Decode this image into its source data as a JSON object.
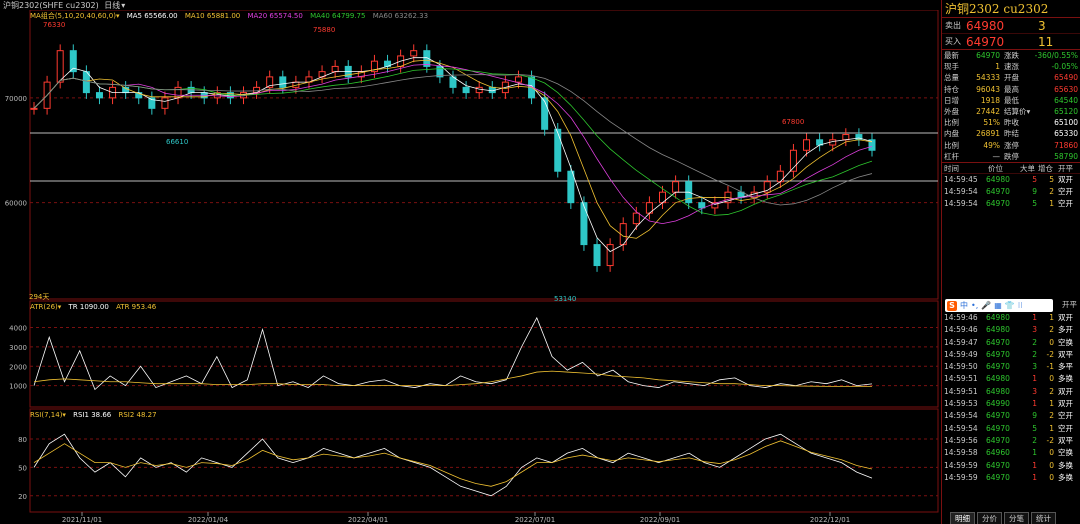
{
  "topbar": {
    "symbol": "沪铜2302(SHFE cu2302)",
    "period": "日线",
    "arrow": "▾"
  },
  "ma": {
    "title": "MA组合(5,10,20,40,60,0)",
    "arrow": "▾",
    "ma5": "MA5 65566.00",
    "ma10": "MA10 65881.00",
    "ma20": "MA20 65574.50",
    "ma40": "MA40 64799.75",
    "ma60": "MA60 63262.33",
    "colors": {
      "ma5": "#ffffff",
      "ma10": "#f1c232",
      "ma20": "#e040e0",
      "ma40": "#2ec72e",
      "ma60": "#888888"
    }
  },
  "price_labels": {
    "high1": "76330",
    "high2": "75880",
    "low1": "66610",
    "high3": "67800",
    "low2": "53140",
    "bars": "294天"
  },
  "atr": {
    "title": "ATR(26)",
    "arrow": "▾",
    "tr": "TR 1090.00",
    "atr": "ATR 953.46"
  },
  "rsi": {
    "title": "RSI(7,14)",
    "arrow": "▾",
    "rsi1": "RSI1 38.66",
    "rsi2": "RSI2 48.27"
  },
  "chart_data": [
    {
      "type": "candlestick",
      "title": "沪铜2302 cu2302 日线",
      "y_ticks": [
        70000,
        60000
      ],
      "x_ticks": [
        "2021/11/01",
        "2022/01/04",
        "2022/04/01",
        "2022/07/01",
        "2022/09/01",
        "2022/12/01"
      ],
      "annotations": {
        "high": 76330,
        "high2": 75880,
        "low": 66610,
        "high3": 67800,
        "low2": 53140
      },
      "close": [
        69000,
        71500,
        74500,
        72500,
        70500,
        70000,
        71000,
        70500,
        70000,
        69000,
        70000,
        71000,
        70500,
        70000,
        70500,
        70000,
        70500,
        71000,
        72000,
        71000,
        71500,
        72000,
        72500,
        73000,
        72000,
        72500,
        73500,
        73000,
        74000,
        74500,
        73000,
        72000,
        71000,
        70500,
        71000,
        70500,
        71500,
        72000,
        70000,
        67000,
        63000,
        60000,
        56000,
        54000,
        56000,
        58000,
        59000,
        60000,
        61000,
        62000,
        60000,
        59500,
        60000,
        61000,
        60500,
        61000,
        62000,
        63000,
        65000,
        66000,
        65500,
        66000,
        66500,
        66000,
        65000
      ]
    },
    {
      "type": "line",
      "title": "ATR(26)",
      "y_ticks": [
        4000,
        3000,
        2000,
        1000
      ],
      "series": [
        {
          "name": "TR",
          "values": [
            1000,
            3500,
            1200,
            2800,
            800,
            1500,
            1000,
            2000,
            900,
            1200,
            1500,
            1100,
            2500,
            900,
            1300,
            3900,
            1000,
            1200,
            900,
            1500,
            1100,
            1000,
            1200,
            1300,
            1000,
            900,
            1100,
            1000,
            1500,
            1200,
            1100,
            1300,
            3000,
            4500,
            2500,
            1800,
            2200,
            1500,
            1800,
            1200,
            1000,
            900,
            1200,
            1100,
            1000,
            1300,
            1400,
            1000,
            900,
            1100,
            1000,
            1200,
            1100,
            1300,
            1000,
            1090
          ]
        },
        {
          "name": "ATR",
          "values": [
            1200,
            1300,
            1350,
            1300,
            1250,
            1200,
            1200,
            1150,
            1100,
            1100,
            1100,
            1100,
            1050,
            1050,
            1050,
            1100,
            1100,
            1050,
            1050,
            1050,
            1000,
            1000,
            1000,
            1000,
            1000,
            1000,
            1000,
            1000,
            1050,
            1100,
            1200,
            1350,
            1500,
            1700,
            1750,
            1700,
            1650,
            1600,
            1500,
            1450,
            1400,
            1300,
            1250,
            1200,
            1150,
            1100,
            1100,
            1050,
            1000,
            1000,
            980,
            970,
            960,
            955,
            953,
            953.46
          ]
        }
      ]
    },
    {
      "type": "line",
      "title": "RSI(7,14)",
      "y_ticks": [
        80,
        50,
        20
      ],
      "series": [
        {
          "name": "RSI1",
          "values": [
            50,
            75,
            85,
            60,
            45,
            55,
            40,
            60,
            50,
            55,
            45,
            60,
            55,
            50,
            65,
            80,
            60,
            55,
            60,
            70,
            65,
            60,
            65,
            70,
            60,
            55,
            50,
            40,
            30,
            25,
            20,
            30,
            50,
            60,
            55,
            65,
            70,
            60,
            55,
            65,
            60,
            55,
            60,
            65,
            55,
            50,
            60,
            70,
            80,
            85,
            75,
            65,
            60,
            55,
            45,
            38.66
          ]
        },
        {
          "name": "RSI2",
          "values": [
            55,
            65,
            75,
            65,
            55,
            55,
            50,
            55,
            52,
            54,
            50,
            55,
            54,
            52,
            58,
            68,
            62,
            58,
            60,
            64,
            62,
            60,
            62,
            65,
            60,
            56,
            52,
            45,
            38,
            33,
            30,
            35,
            45,
            55,
            55,
            60,
            63,
            60,
            57,
            60,
            58,
            56,
            58,
            60,
            56,
            54,
            58,
            64,
            72,
            78,
            72,
            66,
            62,
            58,
            52,
            48.27
          ]
        }
      ]
    }
  ],
  "panel": {
    "title": "沪铜2302  cu2302",
    "ask": {
      "label": "卖出",
      "price": "64980",
      "vol": "3"
    },
    "bid": {
      "label": "买入",
      "price": "64970",
      "vol": "11"
    },
    "stats": [
      {
        "l1": "最新",
        "v1": "64970",
        "c1": "#2ec72e",
        "l2": "涨跌",
        "v2": "-360/0.55%",
        "c2": "#2ec72e"
      },
      {
        "l1": "现手",
        "v1": "1",
        "c1": "#f1c232",
        "l2": "速涨",
        "v2": "-0.05%",
        "c2": "#2ec72e"
      },
      {
        "l1": "总量",
        "v1": "54333",
        "c1": "#f1c232",
        "l2": "开盘",
        "v2": "65490",
        "c2": "#ff3b30"
      },
      {
        "l1": "持仓",
        "v1": "96043",
        "c1": "#f1c232",
        "l2": "最高",
        "v2": "65630",
        "c2": "#ff3b30"
      },
      {
        "l1": "日增",
        "v1": "1918",
        "c1": "#f1c232",
        "l2": "最低",
        "v2": "64540",
        "c2": "#2ec72e"
      },
      {
        "l1": "外盘",
        "v1": "27442",
        "c1": "#f1c232",
        "l2": "结算价▾",
        "v2": "65120",
        "c2": "#2ec72e"
      },
      {
        "l1": "比例",
        "v1": "51%",
        "c1": "#f1c232",
        "l2": "昨收",
        "v2": "65100",
        "c2": "#ffffff"
      },
      {
        "l1": "内盘",
        "v1": "26891",
        "c1": "#f1c232",
        "l2": "昨结",
        "v2": "65330",
        "c2": "#ffffff"
      },
      {
        "l1": "比例",
        "v1": "49%",
        "c1": "#f1c232",
        "l2": "涨停",
        "v2": "71860",
        "c2": "#ff3b30"
      },
      {
        "l1": "杠杆",
        "v1": "—",
        "c1": "#cccccc",
        "l2": "跌停",
        "v2": "58790",
        "c2": "#2ec72e"
      }
    ],
    "tick_headers": {
      "time": "时间",
      "price": "价位",
      "size": "大单",
      "oi": "增仓",
      "type": "开平"
    },
    "ticks_top": [
      {
        "time": "14:59:45",
        "price": "64980",
        "size": "5",
        "size_color": "#ff3b30",
        "oi": "5",
        "type": "双开",
        "type_color": "#ffffff"
      },
      {
        "time": "14:59:54",
        "price": "64970",
        "size": "9",
        "size_color": "#2ec72e",
        "oi": "2",
        "type": "空开",
        "type_color": "#ffffff"
      },
      {
        "time": "14:59:54",
        "price": "64970",
        "size": "5",
        "size_color": "#2ec72e",
        "oi": "1",
        "type": "空开",
        "type_color": "#ffffff"
      }
    ],
    "ime": {
      "logo": "S",
      "items": [
        "中",
        "•,",
        "🎤",
        "▦",
        "👕",
        "⁝⁝"
      ]
    },
    "ticks_bottom_header": "开平",
    "ticks_bottom": [
      {
        "time": "14:59:46",
        "price": "64980",
        "size": "1",
        "size_color": "#ff3b30",
        "oi": "1",
        "type": "双开"
      },
      {
        "time": "14:59:46",
        "price": "64980",
        "size": "3",
        "size_color": "#ff3b30",
        "oi": "2",
        "type": "多开"
      },
      {
        "time": "14:59:47",
        "price": "64970",
        "size": "2",
        "size_color": "#2ec72e",
        "oi": "0",
        "type": "空换"
      },
      {
        "time": "14:59:49",
        "price": "64970",
        "size": "2",
        "size_color": "#2ec72e",
        "oi": "-2",
        "type": "双平"
      },
      {
        "time": "14:59:50",
        "price": "64970",
        "size": "3",
        "size_color": "#2ec72e",
        "oi": "-1",
        "type": "多平"
      },
      {
        "time": "14:59:51",
        "price": "64980",
        "size": "1",
        "size_color": "#ff3b30",
        "oi": "0",
        "type": "多换"
      },
      {
        "time": "14:59:51",
        "price": "64980",
        "size": "3",
        "size_color": "#ff3b30",
        "oi": "2",
        "type": "双开"
      },
      {
        "time": "14:59:53",
        "price": "64990",
        "size": "1",
        "size_color": "#ff3b30",
        "oi": "1",
        "type": "双开"
      },
      {
        "time": "14:59:54",
        "price": "64970",
        "size": "9",
        "size_color": "#2ec72e",
        "oi": "2",
        "type": "空开"
      },
      {
        "time": "14:59:54",
        "price": "64970",
        "size": "5",
        "size_color": "#2ec72e",
        "oi": "1",
        "type": "空开"
      },
      {
        "time": "14:59:56",
        "price": "64970",
        "size": "2",
        "size_color": "#2ec72e",
        "oi": "-2",
        "type": "双平"
      },
      {
        "time": "14:59:58",
        "price": "64960",
        "size": "1",
        "size_color": "#2ec72e",
        "oi": "0",
        "type": "空换"
      },
      {
        "time": "14:59:59",
        "price": "64970",
        "size": "1",
        "size_color": "#ff3b30",
        "oi": "0",
        "type": "多换"
      },
      {
        "time": "14:59:59",
        "price": "64970",
        "size": "1",
        "size_color": "#ff3b30",
        "oi": "0",
        "type": "多换"
      }
    ],
    "tabs": [
      "明细",
      "分价",
      "分笔",
      "统计"
    ]
  }
}
